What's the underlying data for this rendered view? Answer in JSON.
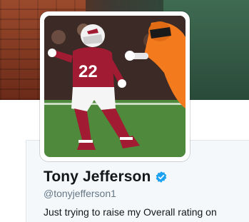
{
  "profile": {
    "display_name": "Tony Jefferson",
    "handle": "@tonyjefferson1",
    "bio": "Just trying to raise my Overall rating on",
    "verified": true
  },
  "avatar": {
    "jersey_number": "22"
  },
  "colors": {
    "verified": "#1da1f2",
    "name": "#14171a",
    "handle": "#657786",
    "cardinals_red": "#a11b32"
  },
  "icons": {
    "verified": "verified-badge-icon"
  }
}
